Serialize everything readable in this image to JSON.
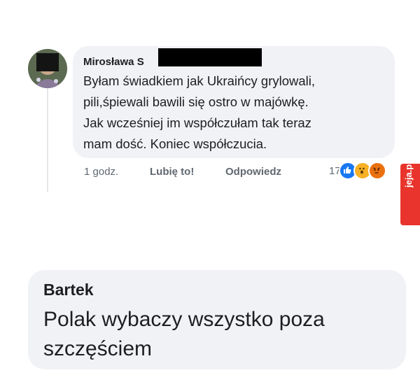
{
  "comment1": {
    "author": "Mirosława S",
    "lines": [
      "Byłam świadkiem jak Ukraińcy grylowali,",
      "pili,śpiewali bawili się ostro w majówkę.",
      "Jak wcześniej im współczułam tak teraz",
      "mam dość. Koniec współczucia."
    ],
    "time": "1 godz.",
    "like_label": "Lubię to!",
    "reply_label": "Odpowiedz",
    "reaction_count": "17",
    "reaction_icons": [
      "like-icon",
      "wow-icon",
      "angry-icon"
    ]
  },
  "comment2": {
    "author": "Bartek",
    "lines": [
      "Polak wybaczy wszystko poza",
      "szczęściem"
    ]
  },
  "watermark": {
    "text": "jeja.pl"
  },
  "colors": {
    "bubble": "#f0f2f5",
    "text": "#1c1e21",
    "meta": "#606770",
    "like": "#1877f2",
    "watermark": "#e8342c"
  }
}
